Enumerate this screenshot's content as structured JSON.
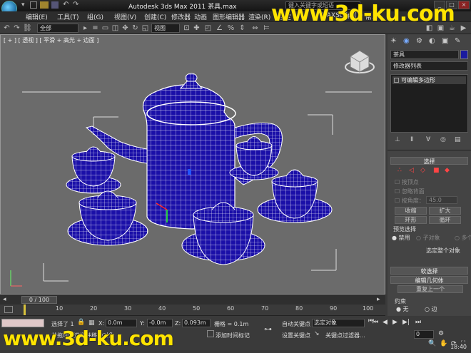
{
  "titlebar": {
    "title": "Autodesk 3ds Max  2011    茶具.max",
    "search_placeholder": "键入关键字或短语"
  },
  "menu": {
    "items": [
      "编辑(E)",
      "工具(T)",
      "组(G)",
      "视图(V)",
      "创建(C)",
      "修改器",
      "动画",
      "图形编辑器",
      "渲染(R)",
      "自定",
      "MAXScript(X)",
      "帮助"
    ]
  },
  "toolbar": {
    "filter_select": "全部",
    "ref_coord_select": "视图"
  },
  "viewport": {
    "label": "[ + ] [ 透视 ] [ 平滑 + 高光 + 边面 ]",
    "mesh_color": "#1a0fa8",
    "wire_color": "#ffffff"
  },
  "panel": {
    "object_name": "茶具",
    "modifier_list_label": "修改器列表",
    "stack_item": "可编辑多边形",
    "selection_rollout": "选择",
    "by_vertex": "按顶点",
    "ignore_backface": "忽略背面",
    "by_angle": "按角度：",
    "angle_value": "45.0",
    "shrink": "收缩",
    "grow": "扩大",
    "ring": "环形",
    "loop": "循环",
    "preview_selection": "预览选择",
    "disabled": "禁用",
    "subobject": "子对象",
    "multi": "多个",
    "select_whole": "选定整个对象",
    "soft_selection_rollout": "软选择",
    "edit_geometry_rollout": "编辑几何体",
    "repeat_last": "重复上一个",
    "constraints": "约束",
    "none": "无",
    "edge": "边"
  },
  "timeline": {
    "slider": "0 / 100",
    "ticks": [
      "10",
      "20",
      "30",
      "40",
      "50",
      "60",
      "70",
      "80",
      "90",
      "100"
    ]
  },
  "status": {
    "selected": "选择了 1",
    "x_label": "X:",
    "x_value": "0.0m",
    "y_label": "Y:",
    "y_value": "-0.0m",
    "z_label": "Z:",
    "z_value": "0.093m",
    "grid_label": "栅格 = 0.1m",
    "auto_key": "自动关键点",
    "selected_object": "选定对象",
    "add_time_tag": "添加时间标记",
    "set_key": "设置关键点",
    "key_filters": "关键点过滤器...",
    "hint_partial": "并拖动以选择并移动对象",
    "frame_value": "0",
    "clock": "18:40"
  },
  "watermark": {
    "text": "www.3d-ku.com"
  }
}
